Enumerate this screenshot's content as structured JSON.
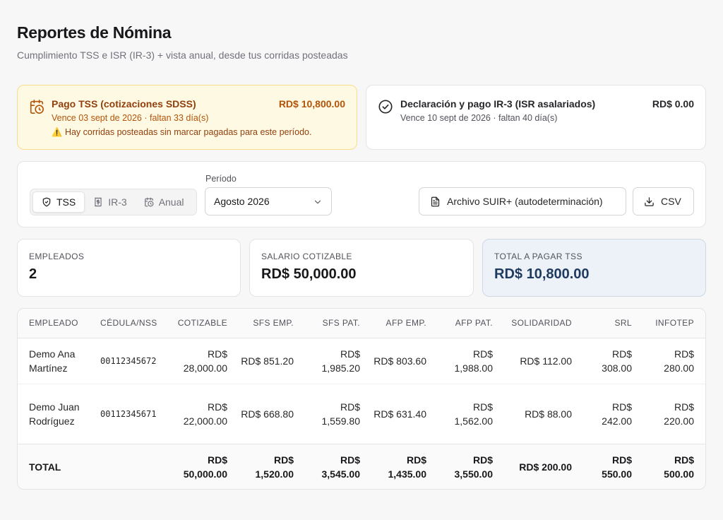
{
  "header": {
    "title": "Reportes de Nómina",
    "subtitle": "Cumplimiento TSS e ISR (IR-3) + vista anual, desde tus corridas posteadas"
  },
  "alerts": [
    {
      "title": "Pago TSS (cotizaciones SDSS)",
      "amount": "RD$ 10,800.00",
      "due": "Vence 03 sept de 2026 · faltan 33 día(s)",
      "warning": "Hay corridas posteadas sin marcar pagadas para este período.",
      "icon": "calendar-clock-icon",
      "color": "#b45309"
    },
    {
      "title": "Declaración y pago IR-3 (ISR asalariados)",
      "amount": "RD$ 0.00",
      "due": "Vence 10 sept de 2026 · faltan 40 día(s)",
      "icon": "check-circle-icon"
    }
  ],
  "toolbar": {
    "tabs": [
      {
        "label": "TSS",
        "icon": "shield-check-icon",
        "active": true
      },
      {
        "label": "IR-3",
        "icon": "receipt-icon",
        "active": false
      },
      {
        "label": "Anual",
        "icon": "calendar-clock-icon",
        "active": false
      }
    ],
    "period_label": "Período",
    "period_value": "Agosto 2026",
    "suir_button": "Archivo SUIR+ (autodeterminación)",
    "csv_button": "CSV"
  },
  "stats": [
    {
      "label": "EMPLEADOS",
      "value": "2"
    },
    {
      "label": "SALARIO COTIZABLE",
      "value": "RD$ 50,000.00"
    },
    {
      "label": "TOTAL A PAGAR TSS",
      "value": "RD$ 10,800.00"
    }
  ],
  "table": {
    "headers": [
      "EMPLEADO",
      "CÉDULA/NSS",
      "COTIZABLE",
      "SFS EMP.",
      "SFS PAT.",
      "AFP EMP.",
      "AFP PAT.",
      "SOLIDARIDAD",
      "SRL",
      "INFOTEP"
    ],
    "rows": [
      [
        "Demo Ana Martínez",
        "00112345672",
        "RD$ 28,000.00",
        "RD$ 851.20",
        "RD$ 1,985.20",
        "RD$ 803.60",
        "RD$ 1,988.00",
        "RD$ 112.00",
        "RD$ 308.00",
        "RD$ 280.00"
      ],
      [
        "Demo Juan Rodríguez",
        "00112345671",
        "RD$ 22,000.00",
        "RD$ 668.80",
        "RD$ 1,559.80",
        "RD$ 631.40",
        "RD$ 1,562.00",
        "RD$ 88.00",
        "RD$ 242.00",
        "RD$ 220.00"
      ]
    ],
    "total": [
      "TOTAL",
      "",
      "RD$ 50,000.00",
      "RD$ 1,520.00",
      "RD$ 3,545.00",
      "RD$ 1,435.00",
      "RD$ 3,550.00",
      "RD$ 200.00",
      "RD$ 550.00",
      "RD$ 500.00"
    ]
  }
}
